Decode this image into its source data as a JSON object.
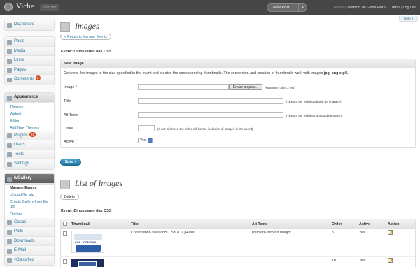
{
  "header": {
    "site_title": "Viche",
    "visit_site": "Visit Site",
    "new_post": "New Post",
    "new_post_arrow": "▾",
    "howdy_prefix": "Howdy,",
    "user_name": "Newton de Góes Horta",
    "sep1": "|",
    "turbo": "Turbo",
    "sep2": "|",
    "logout": "Log Out"
  },
  "help_label": "Help ▾",
  "sidebar": {
    "dashboard": "Dashboard",
    "posts": "Posts",
    "media": "Media",
    "links": "Links",
    "pages": "Pages",
    "comments": "Comments",
    "comments_count": "2",
    "appearance": "Appearance",
    "appearance_sub": [
      "Themes",
      "Widget",
      "Editor",
      "Add New Themes"
    ],
    "plugins": "Plugins",
    "plugins_count": "21",
    "users": "Users",
    "tools": "Tools",
    "settings": "Settings",
    "ivgallery": "IvGallery",
    "ivgallery_sub": [
      "Manage Events",
      "Upload file .zip",
      "Create Gallery from file .zip",
      "Options"
    ],
    "capas": "Capas",
    "polls": "Polls",
    "downloads": "Downloads",
    "email": "E-Mail",
    "vclassified": "vClassified"
  },
  "page": {
    "title": "Images",
    "back_button": "« Return to Manage Events",
    "event_label": "Event: Dinossauro das CSS"
  },
  "new_image": {
    "heading": "New Image",
    "description_pre": "Converts the images to the size specified in the event and creates the corresponding thumbnails. The conversion and creation of thumbnails work with images ",
    "description_formats": "jpg, png e gif.",
    "image_label": "Image *",
    "browse_button": "Enviar arquivo...",
    "image_hint": "(Maximum Size 2 Mb)",
    "title_label": "Title",
    "title_hint": "(Texto a ser exibido abaixo da imagem)",
    "alt_label": "Alt Texto",
    "alt_hint": "(Texto a ser exibido no topo da imagem)",
    "order_label": "Order",
    "order_hint": "(If not informed the order will be the inclusion of images in the event)",
    "active_label": "Active *",
    "active_value": "Yes",
    "save_button": "Save »"
  },
  "list": {
    "title": "List of Images",
    "delete_button": "Delete",
    "event_label": "Event: Dinossauro das CSS",
    "columns": [
      "Thumbnail",
      "Title",
      "Alt Texto",
      "Order",
      "Active",
      "Action"
    ],
    "rows": [
      {
        "thumb_text": "CSS - CONTROL",
        "title": "Construindo sites com CSS e (X)HTML",
        "alt": "Primeiro livro do Maujor",
        "order": "5",
        "active": "Yes"
      },
      {
        "thumb_text": "",
        "title": "",
        "alt": "",
        "order": "10",
        "active": "Yes"
      }
    ]
  }
}
